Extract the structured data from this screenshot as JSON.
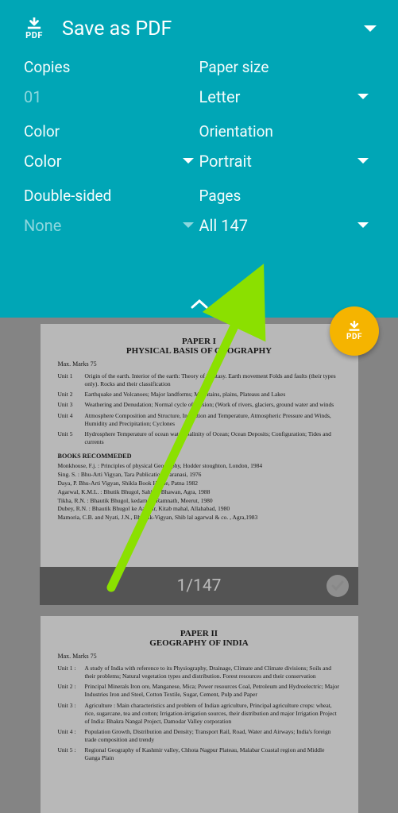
{
  "header": {
    "title": "Save as PDF"
  },
  "fields": {
    "copies": {
      "label": "Copies",
      "value": "01"
    },
    "paper_size": {
      "label": "Paper size",
      "value": "Letter"
    },
    "color": {
      "label": "Color",
      "value": "Color"
    },
    "orientation": {
      "label": "Orientation",
      "value": "Portrait"
    },
    "double_sided": {
      "label": "Double-sided",
      "value": "None"
    },
    "pages": {
      "label": "Pages",
      "value": "All 147"
    }
  },
  "pager": {
    "text": "1/147"
  },
  "preview": {
    "page1": {
      "heading": "PAPER I",
      "subheading": "PHYSICAL BASIS OF GEOGRAPHY",
      "max_marks": "Max. Marks  75",
      "units": [
        {
          "k": "Unit  1",
          "t": "Origin of the earth. Interior of  the earth: Theory of Isostasy. Earth movement  Folds and faults (their types only). Rocks and their classification"
        },
        {
          "k": "Unit  2",
          "t": "Earthquake and Volcanoes; Major landforms; Mountains, plains, Plateaus and Lakes"
        },
        {
          "k": "Unit  3",
          "t": "Weathering and Denudation; Normal cycle of erosion; (Work of rivers, glaciers, ground water and winds"
        },
        {
          "k": "Unit  4",
          "t": "Atmosphere  Composition and Structure, Insolation and Temperature, Atmospheric Pressure and Winds, Humidity and Precipitation; Cyclones"
        },
        {
          "k": "Unit  5",
          "t": "Hydrosphere  Temperature of ocean water, Salinity of Ocean;  Ocean Deposits; Configuration; Tides and currents"
        }
      ],
      "books_heading": "BOOKS RECOMMEDED",
      "books": [
        "Monkhouse, F.j. : Principles of physical Geography, Hodder stoughton, London, 1984",
        "Sing.  S. : Bhu-Arti Vigyan, Tara Publication, Varanasi, 1976",
        "Daya, P. Bhu-Arti Vigyan, Shikla Book House, Patna 1982",
        "Agarwal, K.M.L. : Bhutik Bhugol, Sahitya Bhawan, Agra, 1988",
        "Tikha, R.N. : Bhautik Bhugol, kedarnath Ramnath, Meerut, 1980",
        "Dubey, R.N. : Bhautik Bhugol ke Aadhar, Kitab mahal, Allahabad, 1980",
        "Mamoria, C.B. and Nyati, J.N., Bhautik-Vigyan, Shib lal agarwal & co. , Agra,1983"
      ]
    },
    "page2": {
      "heading": "PAPER II",
      "subheading": "GEOGRAPHY OF INDIA",
      "max_marks": "Max. Marks   75",
      "units": [
        {
          "k": "Unit 1 :",
          "t": "A study of India with reference to its Physiography, Drainage, Climate and Climate divisions; Soils and their problems; Natural vegetation  types and distribution. Forest resources and their conservation"
        },
        {
          "k": "Unit 2 :",
          "t": "Principal Minerals  Iron ore, Manganese, Mica; Power resources  Coal, Petroleum and Hydroelectric; Major Industries  Iron and Steel, Cotton Textile, Sugar, Cement, Pulp and Paper"
        },
        {
          "k": "Unit 3 :",
          "t": "Agriculture : Main characteristics and problem of Indian agriculture, Principal agriculture crops: wheat, rice, sugarcane, tea and cotton; Irrigation-irrigation  sources, their distribution and major Irrigation Project of India: Bhakra Nangal Project, Damodar Valley corporation"
        },
        {
          "k": "Unit 4 :",
          "t": "Population  Growth, Distribution and Density; Transport  Rail, Road, Water and Airways; India's foreign trade composition and trendy"
        },
        {
          "k": "Unit 5 :",
          "t": "Regional Geography of Kashmir valley, Chhota Nagpur Plateau, Malabar Coastal region and Middle Ganga Plain"
        }
      ]
    }
  }
}
